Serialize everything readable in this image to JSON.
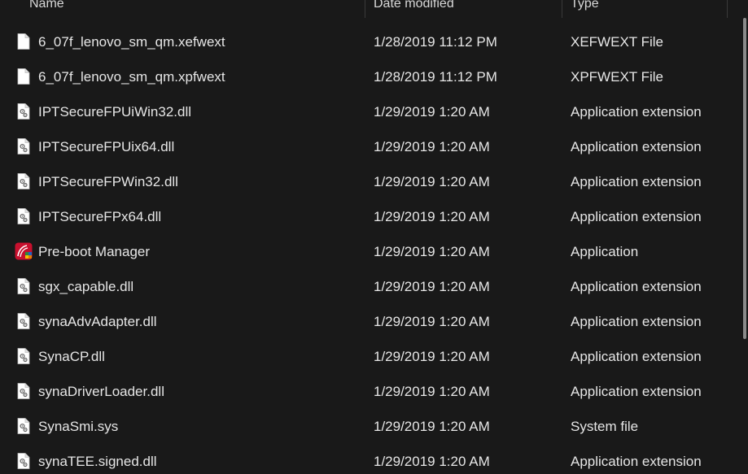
{
  "columns": {
    "name": "Name",
    "date": "Date modified",
    "type": "Type"
  },
  "files": [
    {
      "name": "6_07f_lenovo_sm_qm.xefwext",
      "date": "1/28/2019 11:12 PM",
      "type": "XEFWEXT File",
      "icon": "blank-file-icon"
    },
    {
      "name": "6_07f_lenovo_sm_qm.xpfwext",
      "date": "1/28/2019 11:12 PM",
      "type": "XPFWEXT File",
      "icon": "blank-file-icon"
    },
    {
      "name": "IPTSecureFPUiWin32.dll",
      "date": "1/29/2019 1:20 AM",
      "type": "Application extension",
      "icon": "dll-file-icon"
    },
    {
      "name": "IPTSecureFPUix64.dll",
      "date": "1/29/2019 1:20 AM",
      "type": "Application extension",
      "icon": "dll-file-icon"
    },
    {
      "name": "IPTSecureFPWin32.dll",
      "date": "1/29/2019 1:20 AM",
      "type": "Application extension",
      "icon": "dll-file-icon"
    },
    {
      "name": "IPTSecureFPx64.dll",
      "date": "1/29/2019 1:20 AM",
      "type": "Application extension",
      "icon": "dll-file-icon"
    },
    {
      "name": "Pre-boot Manager",
      "date": "1/29/2019 1:20 AM",
      "type": "Application",
      "icon": "app-icon"
    },
    {
      "name": "sgx_capable.dll",
      "date": "1/29/2019 1:20 AM",
      "type": "Application extension",
      "icon": "dll-file-icon"
    },
    {
      "name": "synaAdvAdapter.dll",
      "date": "1/29/2019 1:20 AM",
      "type": "Application extension",
      "icon": "dll-file-icon"
    },
    {
      "name": "SynaCP.dll",
      "date": "1/29/2019 1:20 AM",
      "type": "Application extension",
      "icon": "dll-file-icon"
    },
    {
      "name": "synaDriverLoader.dll",
      "date": "1/29/2019 1:20 AM",
      "type": "Application extension",
      "icon": "dll-file-icon"
    },
    {
      "name": "SynaSmi.sys",
      "date": "1/29/2019 1:20 AM",
      "type": "System file",
      "icon": "sys-file-icon"
    },
    {
      "name": "synaTEE.signed.dll",
      "date": "1/29/2019 1:20 AM",
      "type": "Application extension",
      "icon": "dll-file-icon"
    }
  ],
  "colors": {
    "background": "#191919",
    "text": "#e6e6e6",
    "app_icon_red": "#c8102e"
  }
}
